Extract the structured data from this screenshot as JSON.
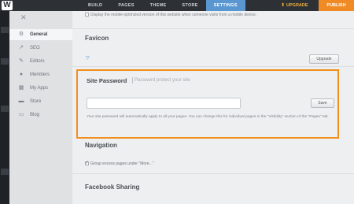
{
  "topbar": {
    "logo": "W",
    "tabs": [
      "BUILD",
      "PAGES",
      "THEME",
      "STORE",
      "SETTINGS"
    ],
    "active_tab": "SETTINGS",
    "upgrade_label": "UPGRADE",
    "publish_label": "PUBLISH",
    "colors": {
      "bar": "#2d3136",
      "active_tab": "#5a97d0",
      "publish": "#f08a24",
      "upgrade": "#f2b03c"
    }
  },
  "sidebar": {
    "close_icon": "close-icon",
    "items": [
      {
        "label": "General",
        "icon": "gear-icon",
        "active": true
      },
      {
        "label": "SEO",
        "icon": "trend-icon",
        "active": false
      },
      {
        "label": "Editors",
        "icon": "pencil-icon",
        "active": false
      },
      {
        "label": "Members",
        "icon": "person-icon",
        "active": false
      },
      {
        "label": "My Apps",
        "icon": "grid-icon",
        "active": false
      },
      {
        "label": "Store",
        "icon": "cart-icon",
        "active": false
      },
      {
        "label": "Blog",
        "icon": "chat-icon",
        "active": false
      }
    ]
  },
  "main": {
    "mobile_text": "Display the mobile-optimized version of this website when someone visits from a mobile device.",
    "favicon_title": "Favicon",
    "favicon_button": "Upgrade",
    "password": {
      "title": "Site Password",
      "subtitle": "Password protect your site",
      "input_value": "",
      "save_label": "Save",
      "help": "Your site password will automatically apply to all your pages. You can change this for individual pages in the \"Visibility\" section of the \"Pages\" tab.",
      "highlight_color": "#f18f1c"
    },
    "navigation_title": "Navigation",
    "group_text": "Group excess pages under \"More...\"",
    "facebook_title": "Facebook Sharing"
  }
}
